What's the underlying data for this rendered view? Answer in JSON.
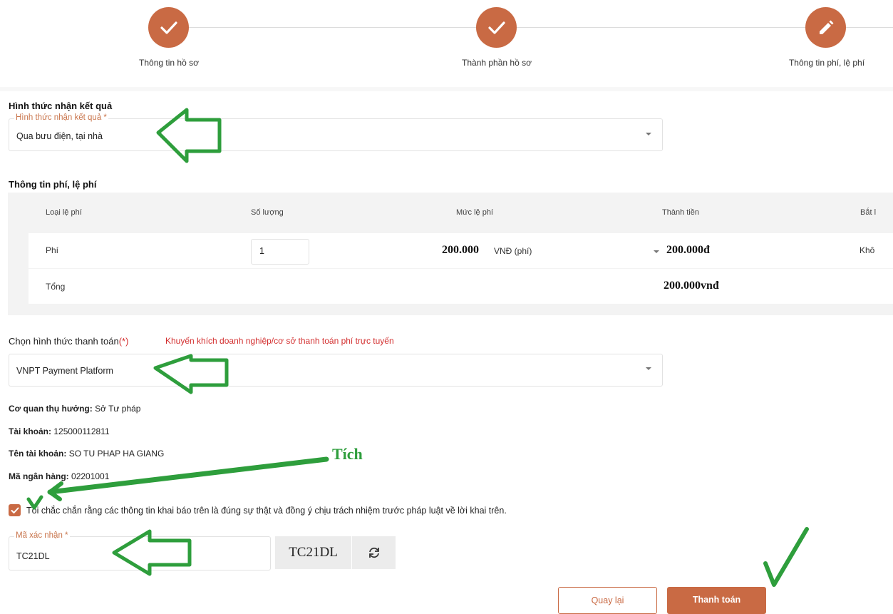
{
  "stepper": {
    "steps": [
      {
        "label": "Thông tin hồ sơ",
        "state": "done",
        "icon": "check-icon"
      },
      {
        "label": "Thành phần hồ sơ",
        "state": "done",
        "icon": "check-icon"
      },
      {
        "label": "Thông tin phí, lệ phí",
        "state": "active",
        "icon": "pencil-icon"
      }
    ]
  },
  "result_method": {
    "section_title": "Hình thức nhận kết quả",
    "field_label": "Hình thức nhận kết quả *",
    "value": "Qua bưu điện, tại nhà"
  },
  "fees": {
    "section_title": "Thông tin phí, lệ phí",
    "columns": [
      "Loại lệ phí",
      "Số lượng",
      "Mức lệ phí",
      "Thành tiền",
      "Bắt l"
    ],
    "rows": [
      {
        "type": "Phí",
        "quantity": "1",
        "amount": "200.000",
        "amount_unit": "VNĐ (phí)",
        "total": "200.000đ",
        "required": "Khô"
      }
    ],
    "total_label": "Tổng",
    "total_value": "200.000vnđ"
  },
  "payment": {
    "label": "Chọn hình thức thanh toán",
    "required_mark": "(*)",
    "hint": "Khuyến khích doanh nghiệp/cơ sở thanh toán phí trực tuyến",
    "value": "VNPT Payment Platform"
  },
  "beneficiary": {
    "agency_label": "Cơ quan thụ hưởng:",
    "agency": "Sở Tư pháp",
    "account_label": "Tài khoản:",
    "account": "125000112811",
    "account_name_label": "Tên tài khoản:",
    "account_name": "SO TU PHAP HA GIANG",
    "bank_code_label": "Mã ngân hàng:",
    "bank_code": "02201001"
  },
  "agreement": {
    "checked": true,
    "text": "Tôi chắc chắn rằng các thông tin khai báo trên là đúng sự thật và đồng ý chịu trách nhiệm trước pháp luật về lời khai trên."
  },
  "captcha": {
    "field_label": "Mã xác nhận *",
    "value": "TC21DL",
    "image_text": "TC21DL"
  },
  "actions": {
    "back_label": "Quay lại",
    "pay_label": "Thanh toán"
  },
  "annotations": {
    "tick_text": "Tích",
    "color": "#2e9e3c"
  },
  "colors": {
    "accent": "#c96a44",
    "label_accent": "#c9754c",
    "hint_red": "#d32f2f"
  }
}
